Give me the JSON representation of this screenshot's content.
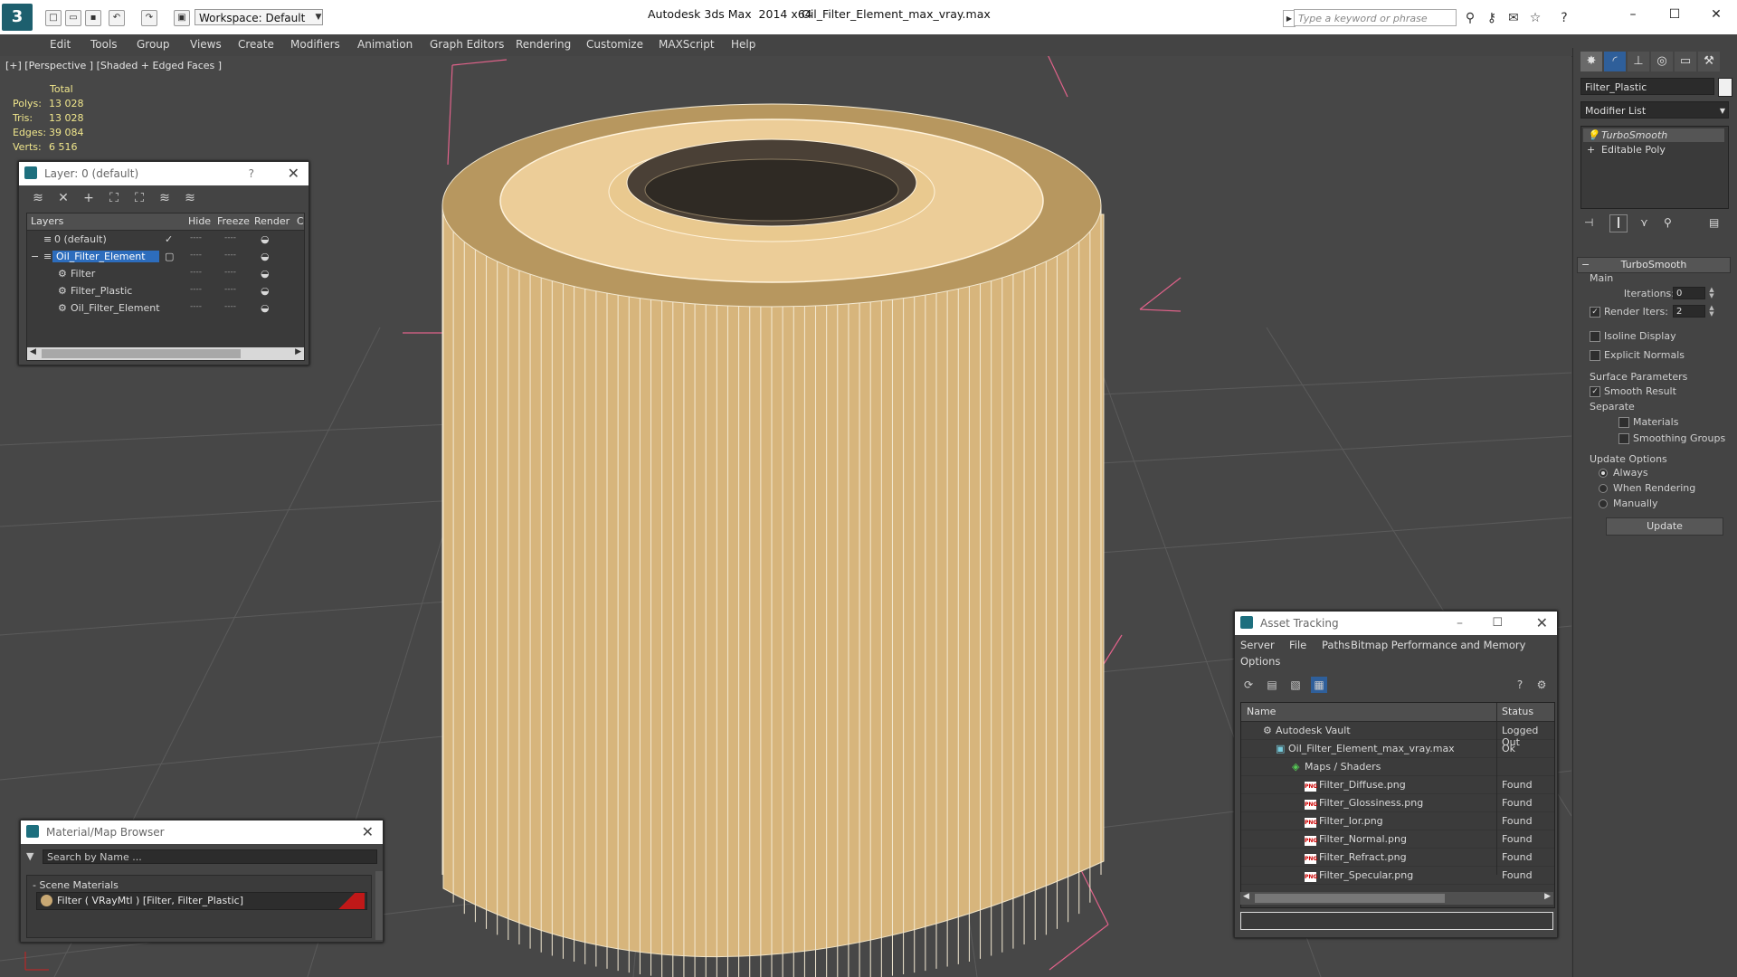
{
  "titlebar": {
    "workspace": "Workspace: Default",
    "app_title": "Autodesk 3ds Max  2014 x64",
    "doc_title": "Oil_Filter_Element_max_vray.max",
    "search_placeholder": "Type a keyword or phrase"
  },
  "menu": [
    "Edit",
    "Tools",
    "Group",
    "Views",
    "Create",
    "Modifiers",
    "Animation",
    "Graph Editors",
    "Rendering",
    "Customize",
    "MAXScript",
    "Help"
  ],
  "viewport": {
    "label": "[+] [Perspective ] [Shaded + Edged Faces ]",
    "stats": {
      "header": "Total",
      "rows": [
        {
          "label": "Polys:",
          "value": "13 028"
        },
        {
          "label": "Tris:",
          "value": "13 028"
        },
        {
          "label": "Edges:",
          "value": "39 084"
        },
        {
          "label": "Verts:",
          "value": "6 516"
        }
      ]
    }
  },
  "layer_panel": {
    "title": "Layer: 0 (default)",
    "help": "?",
    "columns": [
      "Layers",
      "Hide",
      "Freeze",
      "Render",
      "C"
    ],
    "rows": [
      {
        "name": "0 (default)"
      },
      {
        "name": "Oil_Filter_Element"
      },
      {
        "name": "Filter"
      },
      {
        "name": "Filter_Plastic"
      },
      {
        "name": "Oil_Filter_Element"
      }
    ]
  },
  "material_browser": {
    "title": "Material/Map Browser",
    "search_placeholder": "Search by Name ...",
    "section": "- Scene Materials",
    "item": "Filter  ( VRayMtl )  [Filter, Filter_Plastic]"
  },
  "command_panel": {
    "object_name": "Filter_Plastic",
    "modifier_list": "Modifier List",
    "stack": [
      "TurboSmooth",
      "Editable Poly"
    ],
    "rollout": "TurboSmooth",
    "main_label": "Main",
    "iterations_label": "Iterations:",
    "iterations": "0",
    "render_iters_label": "Render Iters:",
    "render_iters": "2",
    "isoline": "Isoline Display",
    "explicit": "Explicit Normals",
    "surface_params": "Surface Parameters",
    "smooth_result": "Smooth Result",
    "separate": "Separate",
    "materials": "Materials",
    "smoothing_groups": "Smoothing Groups",
    "update_options": "Update Options",
    "always": "Always",
    "when_rendering": "When Rendering",
    "manually": "Manually",
    "update_button": "Update"
  },
  "asset_tracking": {
    "title": "Asset Tracking",
    "menu": [
      "Server",
      "File",
      "Paths",
      "Bitmap Performance and Memory",
      "Options"
    ],
    "columns": [
      "Name",
      "Status"
    ],
    "rows": [
      {
        "name": "Autodesk Vault",
        "status": "Logged Out"
      },
      {
        "name": "Oil_Filter_Element_max_vray.max",
        "status": "Ok"
      },
      {
        "name": "Maps / Shaders",
        "status": ""
      },
      {
        "name": "Filter_Diffuse.png",
        "status": "Found"
      },
      {
        "name": "Filter_Glossiness.png",
        "status": "Found"
      },
      {
        "name": "Filter_Ior.png",
        "status": "Found"
      },
      {
        "name": "Filter_Normal.png",
        "status": "Found"
      },
      {
        "name": "Filter_Refract.png",
        "status": "Found"
      },
      {
        "name": "Filter_Specular.png",
        "status": "Found"
      }
    ]
  },
  "colors": {
    "viewport_bg": "#474747",
    "model": "#e8c88f",
    "selection": "#2d6dbd",
    "bounding_box": "#e05a80",
    "grid": "#5a5a5a"
  }
}
